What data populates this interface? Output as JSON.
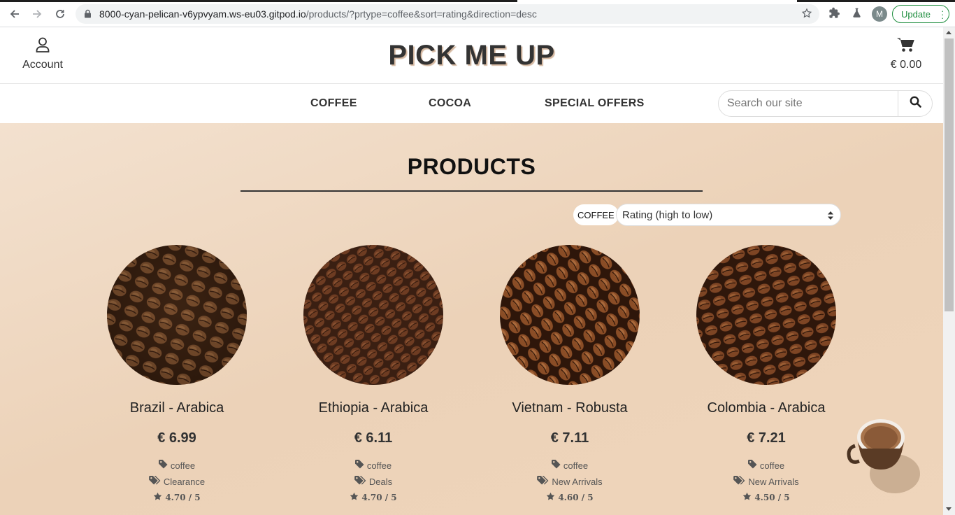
{
  "browser": {
    "url_host": "8000-cyan-pelican-v6ypvyam.ws-eu03.gitpod.io",
    "url_path": "/products/?prtype=coffee&sort=rating&direction=desc",
    "profile_initial": "M",
    "update_label": "Update"
  },
  "header": {
    "account_label": "Account",
    "brand": "PICK ME UP",
    "cart_total": "€ 0.00"
  },
  "nav": {
    "items": [
      "COFFEE",
      "COCOA",
      "SPECIAL OFFERS"
    ],
    "search_placeholder": "Search our site"
  },
  "main": {
    "title": "PRODUCTS",
    "filter_chip": "COFFEE",
    "sort_value": "Rating (high to low)"
  },
  "products": [
    {
      "name": "Brazil - Arabica",
      "price": "€ 6.99",
      "type": "coffee",
      "tag": "Clearance",
      "rating": "4.70 / 5"
    },
    {
      "name": "Ethiopia - Arabica",
      "price": "€ 6.11",
      "type": "coffee",
      "tag": "Deals",
      "rating": "4.70 / 5"
    },
    {
      "name": "Vietnam - Robusta",
      "price": "€ 7.11",
      "type": "coffee",
      "tag": "New Arrivals",
      "rating": "4.60 / 5"
    },
    {
      "name": "Colombia - Arabica",
      "price": "€ 7.21",
      "type": "coffee",
      "tag": "New Arrivals",
      "rating": "4.50 / 5"
    }
  ],
  "icons": {
    "account": "user-icon",
    "cart": "shopping-cart-icon",
    "search": "search-icon",
    "tag": "tag-icon",
    "tags": "tags-icon",
    "star": "star-icon"
  },
  "colors": {
    "background": "#ecd2b8",
    "text": "#333333",
    "update_green": "#1e8e3e"
  }
}
